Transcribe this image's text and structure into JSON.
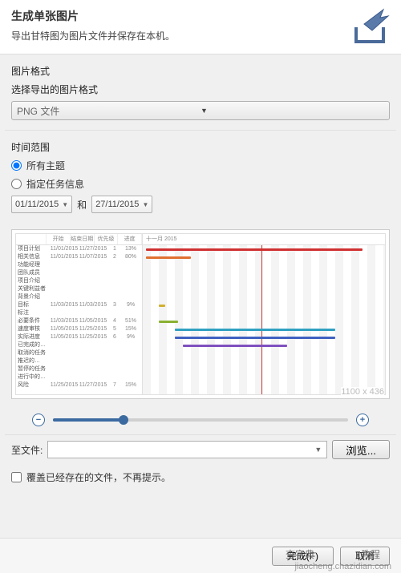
{
  "header": {
    "title": "生成单张图片",
    "subtitle": "导出甘特图为图片文件并保存在本机。"
  },
  "format": {
    "label": "图片格式",
    "sub": "选择导出的图片格式",
    "value": "PNG 文件"
  },
  "time": {
    "label": "时间范围",
    "opt_all": "所有主题",
    "opt_range": "指定任务信息",
    "date_from": "01/11/2015",
    "and": "和",
    "date_to": "27/11/2015"
  },
  "gantt": {
    "month_label": "十一月 2015",
    "cols": [
      "",
      "开始",
      "结束日期",
      "优先级",
      "进度"
    ],
    "rows": [
      {
        "name": "项目计划",
        "s": "11/01/2015",
        "e": "11/27/2015",
        "p": "1",
        "d": "13%"
      },
      {
        "name": "相关信息",
        "s": "11/01/2015",
        "e": "11/07/2015",
        "p": "2",
        "d": "80%"
      },
      {
        "name": "功能经理",
        "s": "",
        "e": "",
        "p": "",
        "d": ""
      },
      {
        "name": "团队成员",
        "s": "",
        "e": "",
        "p": "",
        "d": ""
      },
      {
        "name": "项目介绍",
        "s": "",
        "e": "",
        "p": "",
        "d": ""
      },
      {
        "name": "关键利益者",
        "s": "",
        "e": "",
        "p": "",
        "d": ""
      },
      {
        "name": "背景介绍",
        "s": "",
        "e": "",
        "p": "",
        "d": ""
      },
      {
        "name": "目标",
        "s": "11/03/2015",
        "e": "11/03/2015",
        "p": "3",
        "d": "9%"
      },
      {
        "name": "标注",
        "s": "",
        "e": "",
        "p": "",
        "d": ""
      },
      {
        "name": "必要条件",
        "s": "11/03/2015",
        "e": "11/05/2015",
        "p": "4",
        "d": "51%"
      },
      {
        "name": "速度审核",
        "s": "11/05/2015",
        "e": "11/25/2015",
        "p": "5",
        "d": "15%"
      },
      {
        "name": "实际进度",
        "s": "11/05/2015",
        "e": "11/25/2015",
        "p": "6",
        "d": "9%"
      },
      {
        "name": "已完成的…",
        "s": "",
        "e": "",
        "p": "",
        "d": ""
      },
      {
        "name": "取消的任务",
        "s": "",
        "e": "",
        "p": "",
        "d": ""
      },
      {
        "name": "推迟的…",
        "s": "",
        "e": "",
        "p": "",
        "d": ""
      },
      {
        "name": "暂停的任务",
        "s": "",
        "e": "",
        "p": "",
        "d": ""
      },
      {
        "name": "进行中的…",
        "s": "",
        "e": "",
        "p": "",
        "d": ""
      },
      {
        "name": "风险",
        "s": "11/25/2015",
        "e": "11/27/2015",
        "p": "7",
        "d": "15%"
      }
    ],
    "dim": "1100 x 436"
  },
  "file": {
    "label": "至文件:",
    "browse": "浏览...",
    "value": ""
  },
  "overwrite": "覆盖已经存在的文件，不再提示。",
  "footer": {
    "finish": "完成(F)",
    "cancel": "取消"
  },
  "overlay": {
    "a": "查字典",
    "b": "教程",
    "wm": "jiaocheng.chazidian.com"
  }
}
